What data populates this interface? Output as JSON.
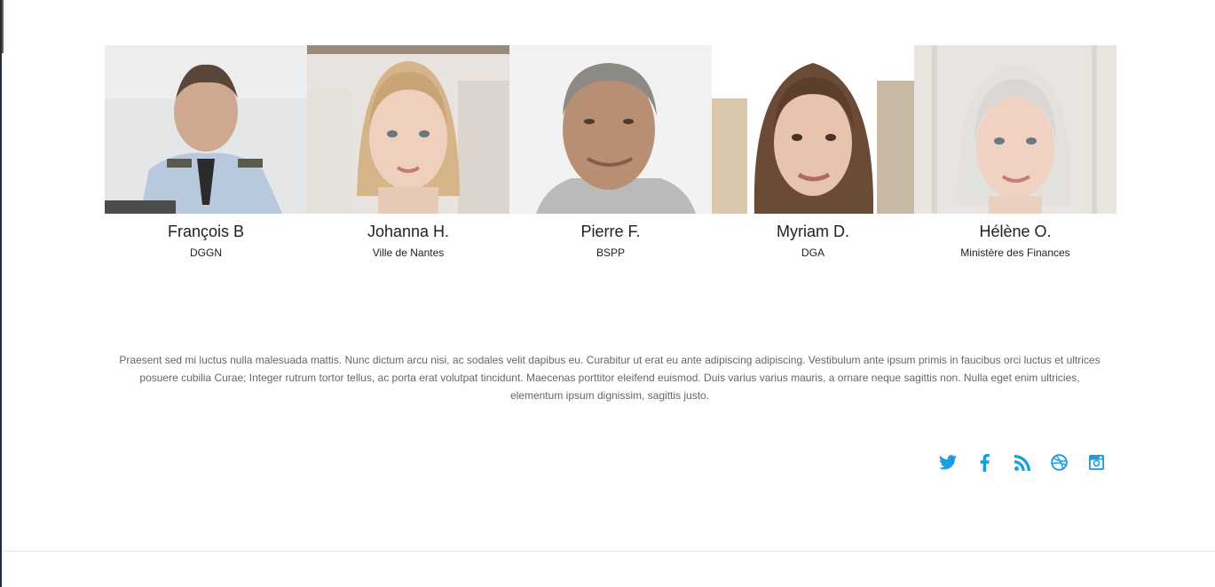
{
  "team": [
    {
      "name": "François B",
      "org": "DGGN",
      "photo": "portrait-uniformed-officer"
    },
    {
      "name": "Johanna H.",
      "org": "Ville de Nantes",
      "photo": "portrait-young-woman"
    },
    {
      "name": "Pierre F.",
      "org": "BSPP",
      "photo": "portrait-smiling-man"
    },
    {
      "name": "Myriam D.",
      "org": "DGA",
      "photo": "portrait-woman-brown-hair"
    },
    {
      "name": "Hélène O.",
      "org": "Ministère des Finances",
      "photo": "portrait-woman-grey-hair"
    }
  ],
  "description": "Praesent sed mi luctus nulla malesuada mattis. Nunc dictum arcu nisi, ac sodales velit dapibus eu. Curabitur ut erat eu ante adipiscing adipiscing. Vestibulum ante ipsum primis in faucibus orci luctus et ultrices posuere cubilia Curae; Integer rutrum tortor tellus, ac porta erat volutpat tincidunt. Maecenas porttitor eleifend euismod. Duis varius varius mauris, a ornare neque sagittis non. Nulla eget enim ultricies, elementum ipsum dignissim, sagittis justo.",
  "social": [
    {
      "icon": "twitter-icon"
    },
    {
      "icon": "facebook-icon"
    },
    {
      "icon": "rss-icon"
    },
    {
      "icon": "dribbble-icon"
    },
    {
      "icon": "instagram-icon"
    }
  ],
  "colors": {
    "accent": "#1a9fdc",
    "text": "#222222",
    "muted": "#666666"
  }
}
